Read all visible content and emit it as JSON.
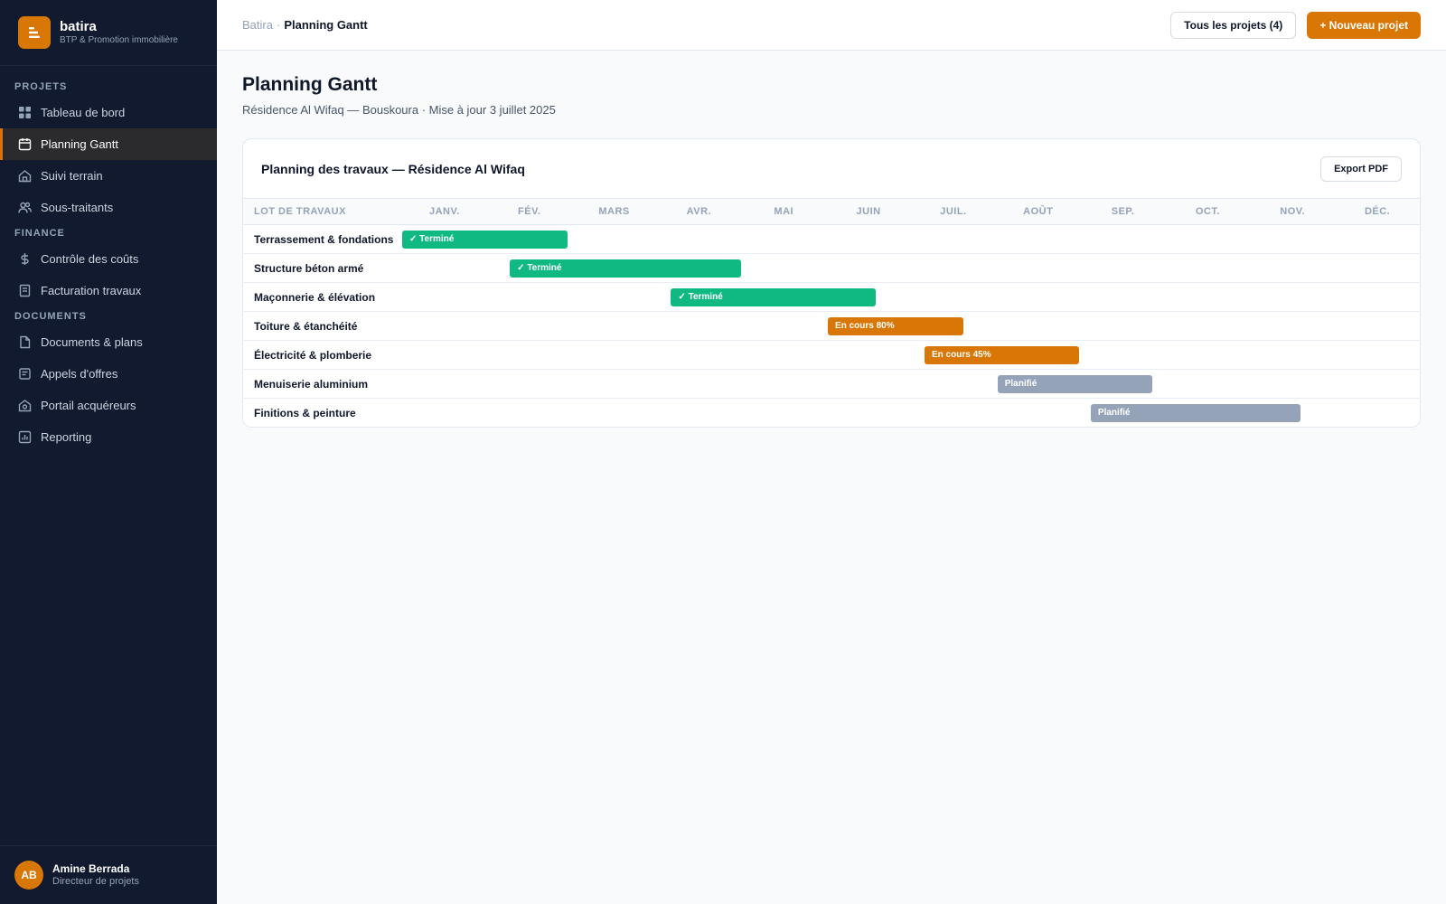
{
  "brand": {
    "name": "batira",
    "subtitle": "BTP & Promotion immobilière"
  },
  "sidebar": {
    "sections": [
      {
        "title": "PROJETS",
        "items": [
          {
            "label": "Tableau de bord",
            "icon": "grid-icon"
          },
          {
            "label": "Planning Gantt",
            "icon": "calendar-icon",
            "active": true
          },
          {
            "label": "Suivi terrain",
            "icon": "home-icon"
          },
          {
            "label": "Sous-traitants",
            "icon": "users-icon"
          }
        ]
      },
      {
        "title": "FINANCE",
        "items": [
          {
            "label": "Contrôle des coûts",
            "icon": "dollar-icon"
          },
          {
            "label": "Facturation travaux",
            "icon": "invoice-icon"
          }
        ]
      },
      {
        "title": "DOCUMENTS",
        "items": [
          {
            "label": "Documents & plans",
            "icon": "file-icon"
          },
          {
            "label": "Appels d'offres",
            "icon": "tender-icon"
          },
          {
            "label": "Portail acquéreurs",
            "icon": "portal-icon"
          },
          {
            "label": "Reporting",
            "icon": "chart-icon"
          }
        ]
      }
    ]
  },
  "user": {
    "initials": "AB",
    "name": "Amine Berrada",
    "role": "Directeur de projets"
  },
  "topbar": {
    "breadcrumb_root": "Batira",
    "breadcrumb_sep": "·",
    "breadcrumb_current": "Planning Gantt",
    "all_projects_label": "Tous les projets (4)",
    "new_project_label": "+ Nouveau projet"
  },
  "page": {
    "title": "Planning Gantt",
    "subtitle": "Résidence Al Wifaq — Bouskoura · Mise à jour 3 juillet 2025"
  },
  "gantt": {
    "title": "Planning des travaux — Résidence Al Wifaq",
    "export_label": "Export PDF",
    "lot_header": "LOT DE TRAVAUX",
    "months": [
      "JANV.",
      "FÉV.",
      "MARS",
      "AVR.",
      "MAI",
      "JUIN",
      "JUIL.",
      "AOÛT",
      "SEP.",
      "OCT.",
      "NOV.",
      "DÉC."
    ],
    "rows": [
      {
        "label": "Terrassement & fondations",
        "start_month": 0.0,
        "end_month": 1.95,
        "status": "done",
        "bar_label": "✓ Terminé"
      },
      {
        "label": "Structure béton armé",
        "start_month": 1.27,
        "end_month": 4.0,
        "status": "done",
        "bar_label": "✓ Terminé"
      },
      {
        "label": "Maçonnerie & élévation",
        "start_month": 3.17,
        "end_month": 5.58,
        "status": "done",
        "bar_label": "✓ Terminé"
      },
      {
        "label": "Toiture & étanchéité",
        "start_month": 5.02,
        "end_month": 6.62,
        "status": "in_progress",
        "bar_label": "En cours 80%"
      },
      {
        "label": "Électricité & plomberie",
        "start_month": 6.16,
        "end_month": 7.98,
        "status": "in_progress",
        "bar_label": "En cours 45%"
      },
      {
        "label": "Menuiserie aluminium",
        "start_month": 7.02,
        "end_month": 8.85,
        "status": "planned",
        "bar_label": "Planifié"
      },
      {
        "label": "Finitions & peinture",
        "start_month": 8.12,
        "end_month": 10.59,
        "status": "planned",
        "bar_label": "Planifié"
      }
    ]
  },
  "colors": {
    "accent": "#d97706",
    "done": "#10b981",
    "in_progress": "#d97706",
    "planned": "#94a3b8",
    "sidebar_bg": "#111a2e"
  }
}
